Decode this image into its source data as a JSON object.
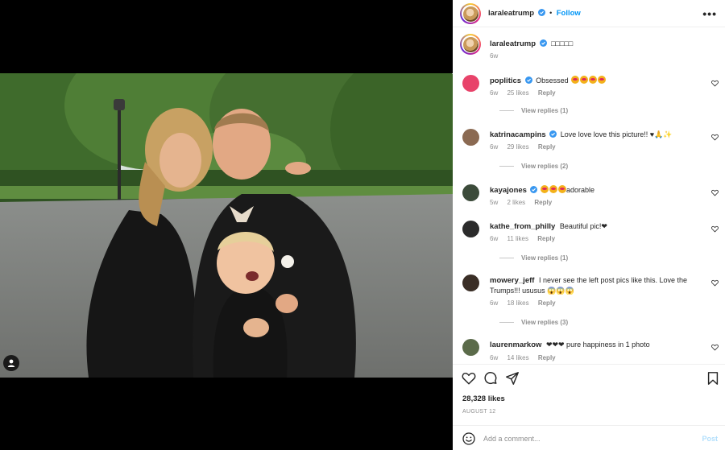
{
  "header": {
    "username": "laraleatrump",
    "dot": "•",
    "follow_label": "Follow",
    "more_icon": "more-horizontal-icon"
  },
  "caption": {
    "username": "laraleatrump",
    "text": "□□□□□",
    "time": "6w"
  },
  "comments": [
    {
      "username": "poplitics",
      "verified": true,
      "text": "Obsessed",
      "emoji_count": 4,
      "time": "6w",
      "likes": "25 likes",
      "reply": "Reply",
      "view_replies": "View replies (1)",
      "avatar_color": "#e8436a"
    },
    {
      "username": "katrinacampins",
      "verified": true,
      "text": "Love love love this picture!! ♥🙏✨",
      "emoji_count": 0,
      "time": "6w",
      "likes": "29 likes",
      "reply": "Reply",
      "view_replies": "View replies (2)",
      "avatar_color": "#8b6a52"
    },
    {
      "username": "kayajones",
      "verified": true,
      "text": "adorable",
      "emoji_count": 3,
      "time": "5w",
      "likes": "2 likes",
      "reply": "Reply",
      "view_replies": "",
      "avatar_color": "#3c4b3a"
    },
    {
      "username": "kathe_from_philly",
      "verified": false,
      "text": "Beautiful pic!❤",
      "emoji_count": 0,
      "time": "6w",
      "likes": "11 likes",
      "reply": "Reply",
      "view_replies": "View replies (1)",
      "avatar_color": "#2b2b2b"
    },
    {
      "username": "mowery_jeff",
      "verified": false,
      "text": "I never see the left post pics like this. Love the Trumps!!! ususus 😱😱😱",
      "emoji_count": 0,
      "time": "6w",
      "likes": "18 likes",
      "reply": "Reply",
      "view_replies": "View replies (3)",
      "avatar_color": "#3a2e26"
    },
    {
      "username": "laurenmarkow",
      "verified": false,
      "text": "❤❤❤ pure happiness in 1 photo",
      "emoji_count": 0,
      "time": "6w",
      "likes": "14 likes",
      "reply": "Reply",
      "view_replies": "",
      "avatar_color": "#5b6b4a"
    }
  ],
  "actions": {
    "like_icon": "heart-icon",
    "comment_icon": "comment-icon",
    "share_icon": "share-icon",
    "save_icon": "bookmark-icon",
    "likes": "28,328 likes",
    "date": "AUGUST 12"
  },
  "composer": {
    "placeholder": "Add a comment...",
    "post_label": "Post",
    "emoji_icon": "smile-icon"
  },
  "colors": {
    "accent": "#0095f6",
    "muted": "#8e8e8e",
    "post_disabled": "#b2dffc",
    "verified": "#3897f0"
  }
}
